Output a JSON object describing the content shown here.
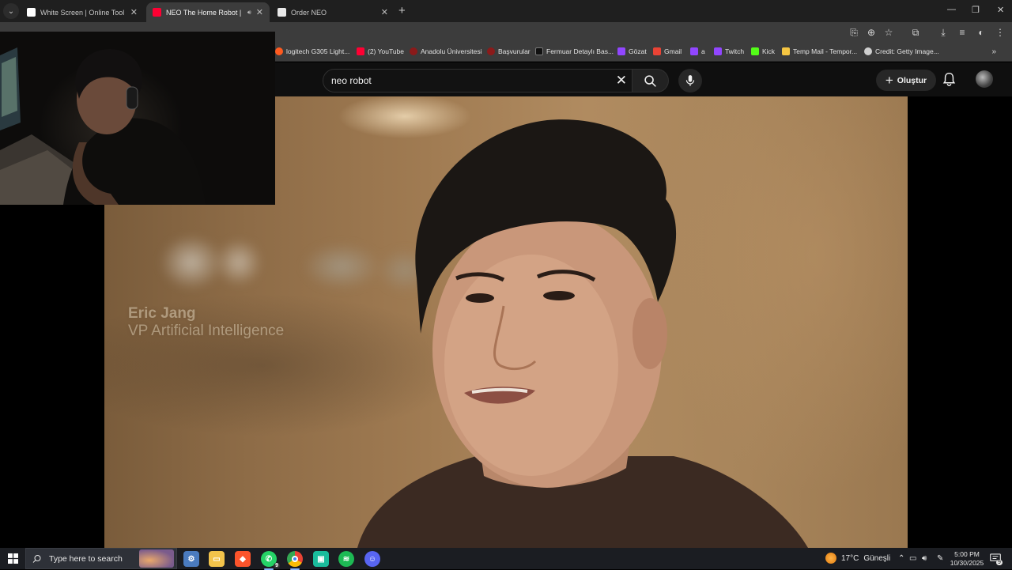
{
  "browser": {
    "tabs": [
      {
        "title": "White Screen | Online Tool",
        "favicon_color": "#ffffff",
        "active": false
      },
      {
        "title": "NEO The Home Robot | Ord",
        "favicon_color": "#ff0033",
        "active": true
      },
      {
        "title": "Order NEO",
        "favicon_color": "#e8e8e8",
        "active": false
      }
    ],
    "bookmarks": [
      {
        "label": "logitech G305 Light...",
        "color": "#ff5a1f"
      },
      {
        "label": "(2) YouTube",
        "color": "#ff0033"
      },
      {
        "label": "Anadolu Üniversitesi",
        "color": "#8b1a1a"
      },
      {
        "label": "Başvurular",
        "color": "#8b1a1a"
      },
      {
        "label": "Fermuar Detaylı Bas...",
        "color": "#111111"
      },
      {
        "label": "Gözat",
        "color": "#9146ff"
      },
      {
        "label": "Gmail",
        "color": "#ea4335"
      },
      {
        "label": "a",
        "color": "#9146ff"
      },
      {
        "label": "Twitch",
        "color": "#9146ff"
      },
      {
        "label": "Kick",
        "color": "#53fc18"
      },
      {
        "label": "Temp Mail - Tempor...",
        "color": "#f5c542"
      },
      {
        "label": "Credit: Getty Image...",
        "color": "#cfcfcf"
      }
    ]
  },
  "youtube": {
    "search_value": "neo robot",
    "create_label": "Oluştur",
    "accent": "#ff0033"
  },
  "video": {
    "speaker_name": "Eric Jang",
    "speaker_role": "VP Artificial Intelligence"
  },
  "taskbar": {
    "search_placeholder": "Type here to search",
    "whatsapp_badge": "9",
    "weather_temp": "17°C",
    "weather_text": "Güneşli",
    "time": "5:00 PM",
    "date": "10/30/2025",
    "notif_count": "9"
  }
}
